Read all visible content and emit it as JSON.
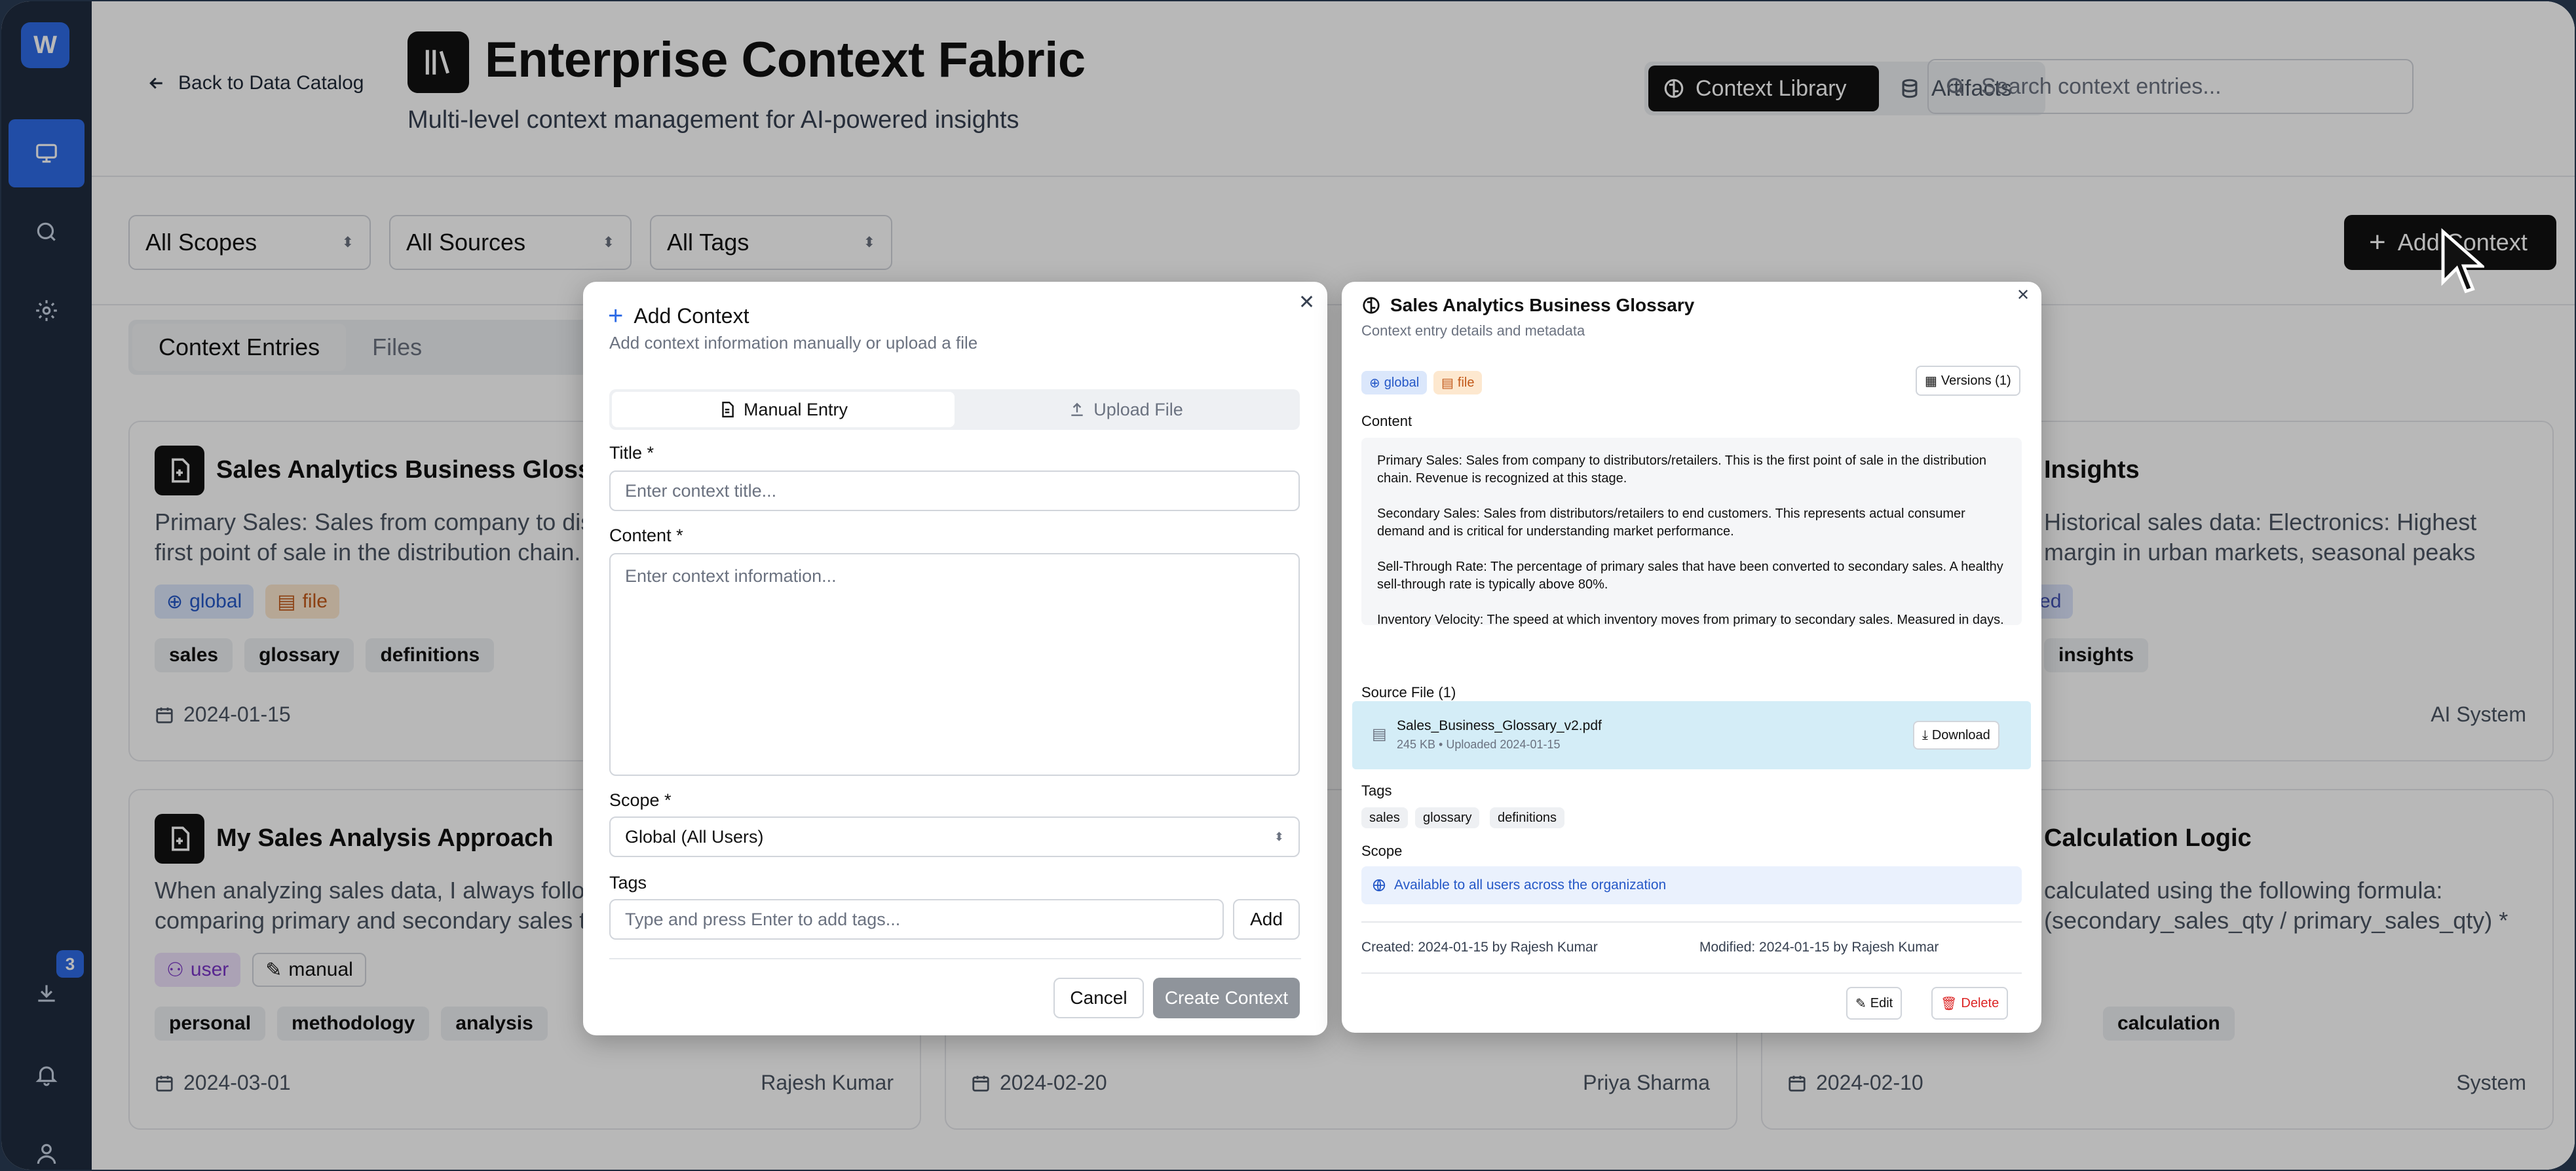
{
  "rail": {
    "logo": "W",
    "download_badge": "3"
  },
  "header": {
    "back_label": "Back to Data Catalog",
    "title": "Enterprise Context Fabric",
    "subtitle": "Multi-level context management for AI-powered insights",
    "toggle": [
      "Context Library",
      "Artifacts"
    ],
    "search_placeholder": "Search context entries..."
  },
  "filters": {
    "scopes": "All Scopes",
    "sources": "All Sources",
    "tags": "All Tags",
    "add_button": "Add Context"
  },
  "tabs": [
    "Context Entries",
    "Files"
  ],
  "cards": [
    {
      "title": "Sales Analytics Business Glossary",
      "desc": "Primary Sales: Sales from company to distributors/retailers. This is the first point of sale in the distribution chain. Revenue is recognized...",
      "badges": [
        "global",
        "file"
      ],
      "tags": [
        "sales",
        "glossary",
        "definitions"
      ],
      "date": "2024-01-15",
      "author": ""
    },
    {
      "title": "Insights",
      "desc": "Historical sales data: Electronics: Highest margin in urban markets, seasonal peaks during festivals....",
      "badges": [
        "ated"
      ],
      "tags": [
        "insights"
      ],
      "date": "",
      "author": "AI System"
    },
    {
      "title": "My Sales Analysis Approach",
      "desc": "When analyzing sales data, I always follow a systematic approach, comparing primary and secondary sales trends to understand company performance...",
      "badges": [
        "user",
        "manual"
      ],
      "tags": [
        "personal",
        "methodology",
        "analysis"
      ],
      "date": "2024-03-01",
      "author": "Rajesh Kumar"
    },
    {
      "title": "",
      "desc": "",
      "badges": [],
      "tags": [],
      "date": "2024-02-20",
      "author": "Priya Sharma"
    },
    {
      "title": "Calculation Logic",
      "desc": "calculated using the following formula: (secondary_sales_qty / primary_sales_qty) * 100...",
      "badges": [],
      "tags": [
        "calculation"
      ],
      "date": "2024-02-10",
      "author": "System"
    }
  ],
  "add_modal": {
    "title": "Add Context",
    "subtitle": "Add context information manually or upload a file",
    "seg_manual": "Manual Entry",
    "seg_upload": "Upload File",
    "title_label": "Title *",
    "title_placeholder": "Enter context title...",
    "content_label": "Content *",
    "content_placeholder": "Enter context information...",
    "scope_label": "Scope *",
    "scope_value": "Global (All Users)",
    "tags_label": "Tags",
    "tags_placeholder": "Type and press Enter to add tags...",
    "add_tag": "Add",
    "cancel": "Cancel",
    "create": "Create Context"
  },
  "detail_modal": {
    "title": "Sales Analytics Business Glossary",
    "subtitle": "Context entry details and metadata",
    "badge_global": "global",
    "badge_file": "file",
    "versions": "Versions (1)",
    "content_label": "Content",
    "content": [
      "Primary Sales: Sales from company to distributors/retailers. This is the first point of sale in the distribution chain. Revenue is recognized at this stage.",
      "Secondary Sales: Sales from distributors/retailers to end customers. This represents actual consumer demand and is critical for understanding market performance.",
      "Sell-Through Rate: The percentage of primary sales that have been converted to secondary sales. A healthy sell-through rate is typically above 80%.",
      "Inventory Velocity: The speed at which inventory moves from primary to secondary sales. Measured in days."
    ],
    "source_label": "Source File (1)",
    "file_name": "Sales_Business_Glossary_v2.pdf",
    "file_meta": "245 KB • Uploaded 2024-01-15",
    "download": "Download",
    "tags_label": "Tags",
    "tags": [
      "sales",
      "glossary",
      "definitions"
    ],
    "scope_label": "Scope",
    "scope_text": "Available to all users across the organization",
    "created": "Created: 2024-01-15 by Rajesh Kumar",
    "modified": "Modified: 2024-01-15 by Rajesh Kumar",
    "edit": "Edit",
    "delete": "Delete"
  },
  "colors": {
    "accent": "#2e6be6",
    "rail": "#1f2c3f",
    "danger": "#dc2626"
  }
}
